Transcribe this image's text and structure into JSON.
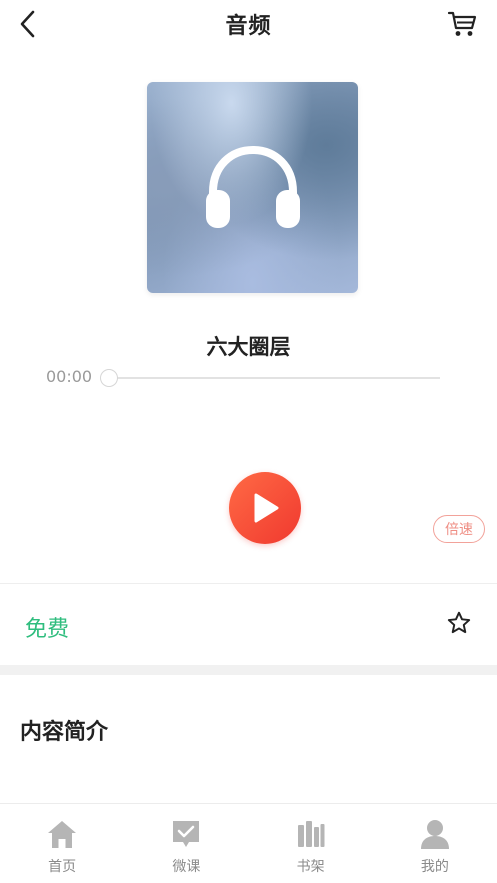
{
  "header": {
    "title": "音频"
  },
  "player": {
    "track_title": "六大圈层",
    "current_time": "00:00",
    "progress": 0,
    "speed_label": "倍速"
  },
  "price": {
    "label": "免费"
  },
  "section": {
    "intro_title": "内容简介"
  },
  "tabbar": {
    "items": [
      {
        "label": "首页",
        "icon": "home-icon"
      },
      {
        "label": "微课",
        "icon": "course-icon"
      },
      {
        "label": "书架",
        "icon": "bookshelf-icon"
      },
      {
        "label": "我的",
        "icon": "profile-icon"
      }
    ]
  },
  "colors": {
    "play_accent": "#f0392f",
    "price_green": "#2fbd7e",
    "speed_border": "#f2a29a",
    "tab_icon_gray": "#b5b5b5"
  }
}
